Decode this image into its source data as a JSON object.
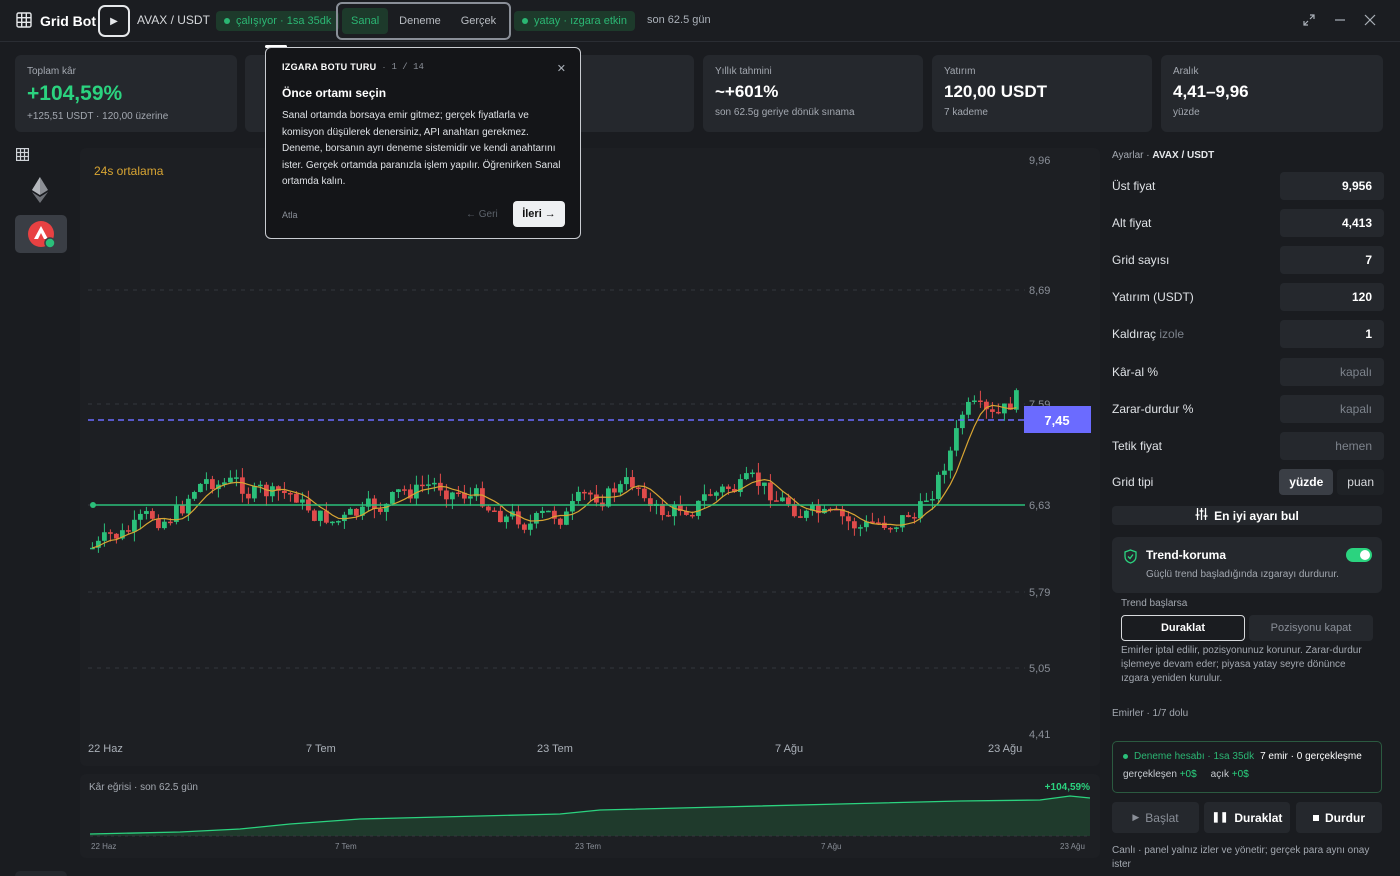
{
  "app": {
    "title": "Grid Bot",
    "pair": "AVAX / USDT",
    "status": "çalışıyor · 1sa 35dk",
    "mode_status": "yatay · ızgara etkin",
    "period": "son 62.5 gün"
  },
  "env_tabs": [
    "Sanal",
    "Deneme",
    "Gerçek"
  ],
  "stats": [
    {
      "label": "Toplam kâr",
      "value": "+104,59%",
      "sub": "+125,51 USDT · 120,00 üzerine"
    },
    {
      "label": "Yıllık tahmini",
      "value": "~+601%",
      "sub": "son 62.5g geriye dönük sınama"
    },
    {
      "label": "Yatırım",
      "value": "120,00 USDT",
      "sub": "7 kademe"
    },
    {
      "label": "Aralık",
      "value": "4,41–9,96",
      "sub": "yüzde"
    }
  ],
  "chart_data": {
    "type": "candlestick",
    "legend_label": "24s ortalama",
    "y_ticks": [
      "9,96",
      "8,69",
      "7,59",
      "6,63",
      "5,79",
      "5,05",
      "4,41"
    ],
    "x_ticks": [
      "22 Haz",
      "7 Tem",
      "23 Tem",
      "7 Ağu",
      "23 Ağu"
    ],
    "current_price": "7,45",
    "ylim": [
      4.41,
      9.96
    ],
    "grid_levels": [
      9.96,
      8.69,
      7.59,
      6.63,
      5.79,
      5.05,
      4.41
    ]
  },
  "curve": {
    "label": "Kâr eğrisi · son 62.5 gün",
    "value": "+104,59%",
    "x_ticks": [
      "22 Haz",
      "7 Tem",
      "23 Tem",
      "7 Ağu",
      "23 Ağu"
    ]
  },
  "settings": {
    "title_prefix": "Ayarlar · ",
    "title_pair": "AVAX / USDT",
    "rows": [
      {
        "label": "Üst fiyat",
        "value": "9,956"
      },
      {
        "label": "Alt fiyat",
        "value": "4,413"
      },
      {
        "label": "Grid sayısı",
        "value": "7"
      },
      {
        "label": "Yatırım (USDT)",
        "value": "120"
      },
      {
        "label": "Kaldıraç",
        "hint": "izole",
        "value": "1"
      },
      {
        "label": "Kâr-al %",
        "value": "kapalı"
      },
      {
        "label": "Zarar-durdur %",
        "value": "kapalı"
      },
      {
        "label": "Tetik fiyat",
        "value": "hemen"
      }
    ],
    "grid_type_label": "Grid tipi",
    "grid_type_options": [
      "yüzde",
      "puan"
    ],
    "best_button": "En iyi ayarı bul"
  },
  "trend": {
    "title": "Trend-koruma",
    "desc": "Güçlü trend başladığında ızgarayı durdurur.",
    "if_label": "Trend başlarsa",
    "options": [
      "Duraklat",
      "Pozisyonu kapat"
    ],
    "explain": "Emirler iptal edilir, pozisyonunuz korunur. Zarar-durdur işlemeye devam eder; piyasa yatay seyre dönünce ızgara yeniden kurulur."
  },
  "orders": {
    "label": "Emirler · 1/7 dolu",
    "account": "Deneme hesabı · 1sa 35dk",
    "summary": "7 emir · 0 gerçekleşme",
    "filled_label": "gerçekleşen",
    "filled_value": "+0$",
    "open_label": "açık",
    "open_value": "+0$"
  },
  "controls": {
    "start": "Başlat",
    "pause": "Duraklat",
    "stop": "Durdur"
  },
  "footnote": "Canlı · panel yalnız izler ve yönetir; gerçek para aynı onay ister",
  "tour": {
    "header": "IZGARA BOTU TURU",
    "step": "1 / 14",
    "title": "Önce ortamı seçin",
    "body": "Sanal ortamda borsaya emir gitmez; gerçek fiyatlarla ve komisyon düşülerek denersiniz, API anahtarı gerekmez. Deneme, borsanın ayrı deneme sistemidir ve kendi anahtarını ister. Gerçek ortamda paranızla işlem yapılır. Öğrenirken Sanal ortamda kalın.",
    "skip": "Atla",
    "back": "← Geri",
    "next": "İleri →"
  },
  "colors": {
    "up": "#2bbf7a",
    "down": "#e04b4b",
    "accent": "#2bd37f",
    "price_line": "#6b6bff"
  }
}
